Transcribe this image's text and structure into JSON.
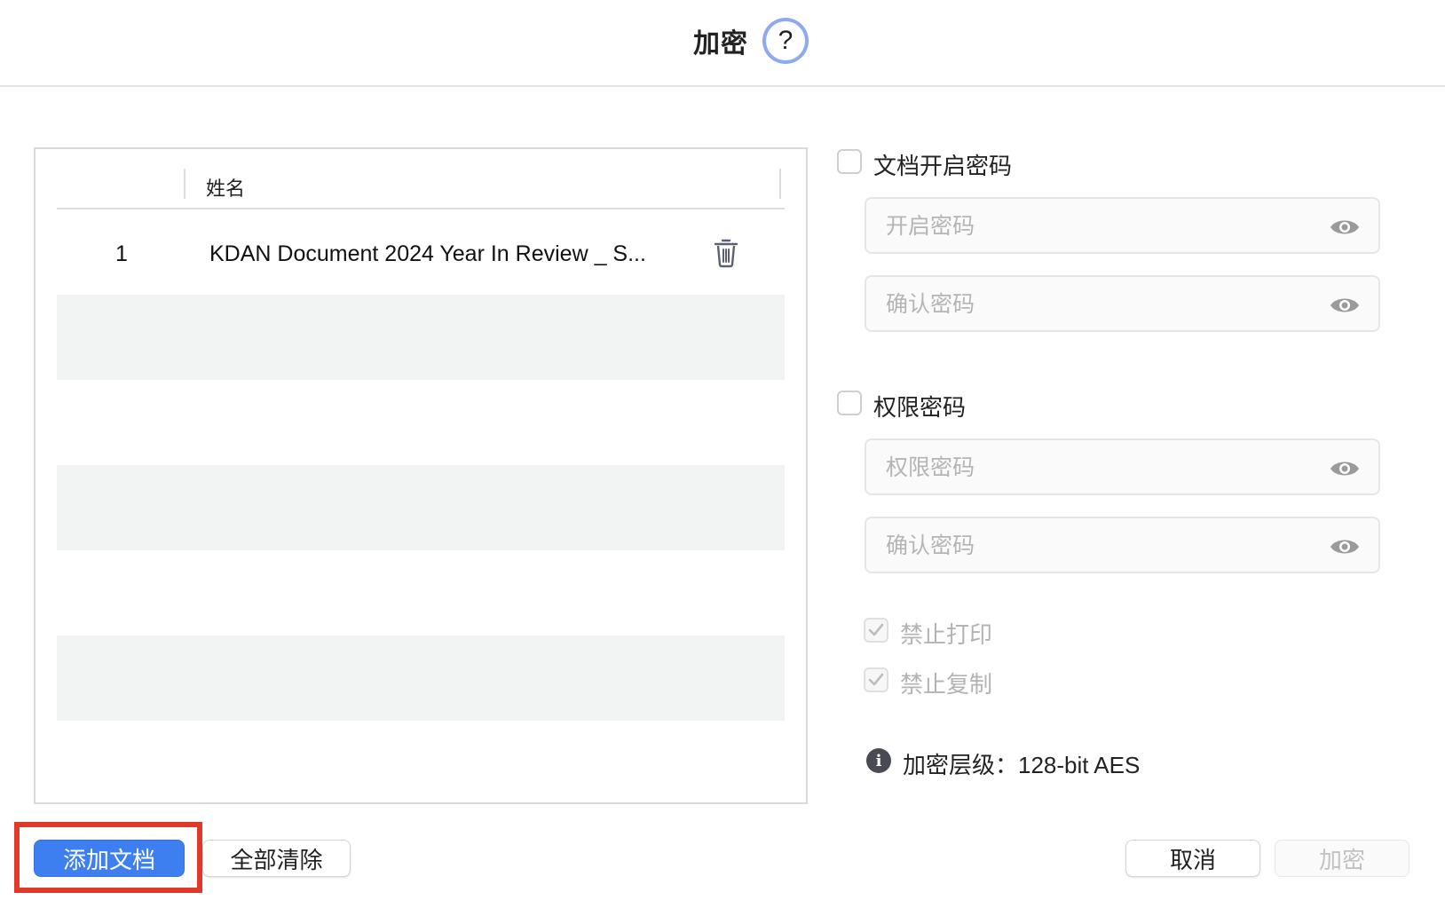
{
  "dialog": {
    "title": "加密",
    "help_label": "?"
  },
  "file_table": {
    "column_header": "姓名",
    "rows": [
      {
        "index": "1",
        "name": "KDAN Document 2024 Year In Review _ S..."
      }
    ]
  },
  "open_password": {
    "label": "文档开启密码",
    "checked": false,
    "password_placeholder": "开启密码",
    "confirm_placeholder": "确认密码"
  },
  "permission_password": {
    "label": "权限密码",
    "checked": false,
    "password_placeholder": "权限密码",
    "confirm_placeholder": "确认密码",
    "options": [
      {
        "label": "禁止打印",
        "checked": true,
        "disabled": true
      },
      {
        "label": "禁止复制",
        "checked": true,
        "disabled": true
      }
    ]
  },
  "encryption_info": {
    "text": "加密层级：128-bit AES"
  },
  "buttons": {
    "add_document": "添加文档",
    "clear_all": "全部清除",
    "cancel": "取消",
    "encrypt": "加密"
  },
  "colors": {
    "accent": "#3d7ff0",
    "highlight": "#e0392b",
    "help_ring": "#8ea9ef"
  },
  "icons": {
    "help": "question-mark-icon",
    "delete": "trash-icon",
    "show_password": "eye-icon",
    "info": "info-icon",
    "check": "checkmark-icon"
  }
}
